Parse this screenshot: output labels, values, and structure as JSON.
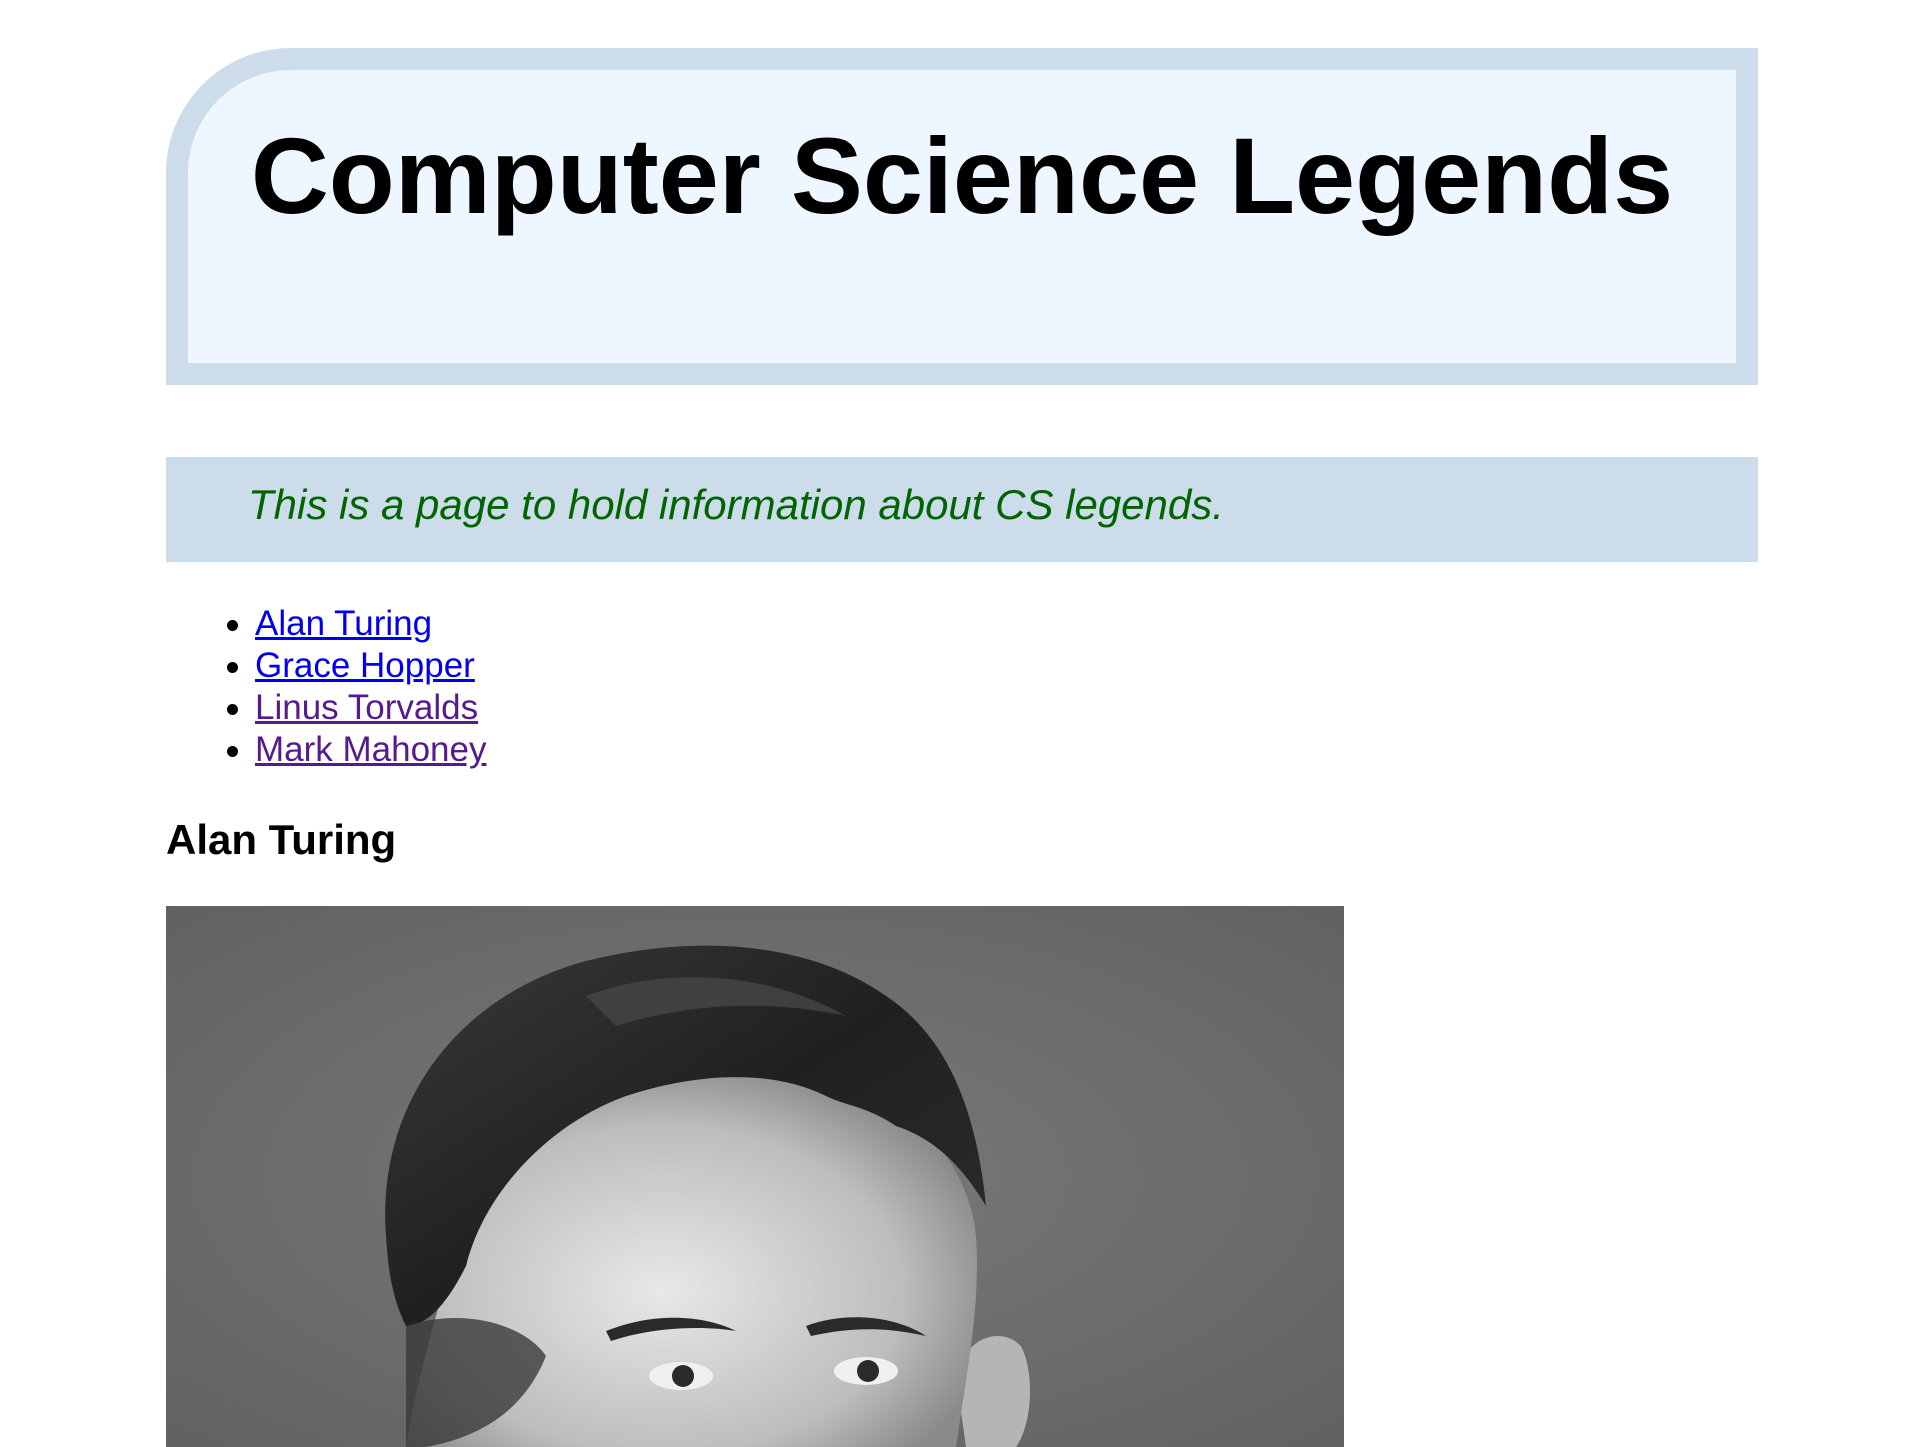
{
  "header": {
    "title": "Computer Science Legends"
  },
  "intro": {
    "text": "This is a page to hold information about CS legends."
  },
  "nav": {
    "items": [
      {
        "label": "Alan Turing",
        "state": "unvisited"
      },
      {
        "label": "Grace Hopper",
        "state": "unvisited"
      },
      {
        "label": "Linus Torvalds",
        "state": "visited"
      },
      {
        "label": "Mark Mahoney",
        "state": "visited"
      }
    ]
  },
  "section": {
    "heading": "Alan Turing"
  },
  "colors": {
    "header_bg": "#eef6ff",
    "header_border": "#ccdcea",
    "intro_bg": "#ccdcea",
    "intro_text": "#006400",
    "link_unvisited": "#0000ee",
    "link_visited": "#551a8b"
  }
}
